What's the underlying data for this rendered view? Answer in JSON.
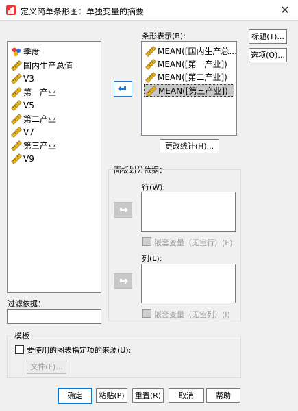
{
  "window": {
    "title": "定义简单条形图：单独变量的摘要"
  },
  "variables": {
    "items": [
      {
        "label": "季度",
        "icon": "nominal-variable-icon"
      },
      {
        "label": "国内生产总值",
        "icon": "scale-variable-icon"
      },
      {
        "label": "V3",
        "icon": "scale-variable-icon"
      },
      {
        "label": "第一产业",
        "icon": "scale-variable-icon"
      },
      {
        "label": "V5",
        "icon": "scale-variable-icon"
      },
      {
        "label": "第二产业",
        "icon": "scale-variable-icon"
      },
      {
        "label": "V7",
        "icon": "scale-variable-icon"
      },
      {
        "label": "第三产业",
        "icon": "scale-variable-icon"
      },
      {
        "label": "V9",
        "icon": "scale-variable-icon"
      }
    ]
  },
  "bars": {
    "label": "条形表示(B):",
    "items": [
      {
        "label": "MEAN([国内生产总...",
        "selected": false
      },
      {
        "label": "MEAN([第一产业])",
        "selected": false
      },
      {
        "label": "MEAN([第二产业])",
        "selected": false
      },
      {
        "label": "MEAN([第三产业])",
        "selected": true
      }
    ],
    "change_stat": "更改统计(H)..."
  },
  "side_buttons": {
    "titles": "标题(T)...",
    "options": "选项(O)..."
  },
  "panel": {
    "label": "面板划分依据：",
    "rows_label": "行(W):",
    "rows_nest": "嵌套变量（无空行）(E)",
    "cols_label": "列(L):",
    "cols_nest": "嵌套变量（无空列）(I)"
  },
  "filter": {
    "label": "过滤依据：",
    "value": ""
  },
  "template": {
    "label": "模板",
    "use_chart": "要使用的图表指定项的来源(U):",
    "file_button": "文件(F)..."
  },
  "footer": {
    "ok": "确定",
    "paste": "粘贴(P)",
    "reset": "重置(R)",
    "cancel": "取消",
    "help": "帮助"
  },
  "colors": {
    "accent": "#0078d7",
    "ruler": "#d4a017",
    "nominal": "#3b6fd6"
  }
}
